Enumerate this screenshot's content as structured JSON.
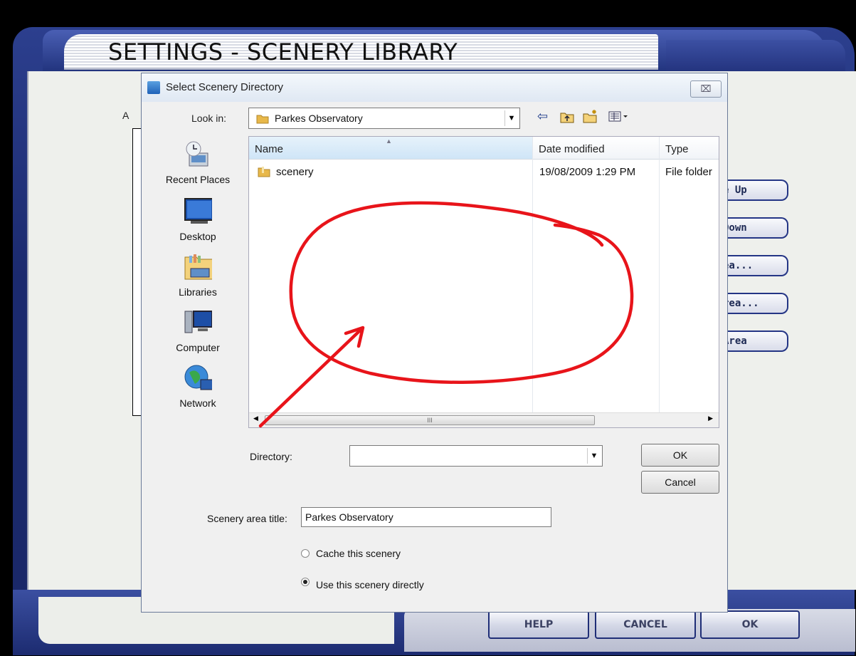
{
  "app": {
    "title": "SETTINGS - SCENERY LIBRARY"
  },
  "background": {
    "list_header": "A",
    "side_buttons": [
      "e Up",
      "Down",
      "ea...",
      "rea...",
      "Area"
    ],
    "footer_buttons": {
      "help": "HELP",
      "cancel": "CANCEL",
      "ok": "OK"
    }
  },
  "dialog": {
    "title": "Select Scenery Directory",
    "close": "⌧",
    "look_in_label": "Look in:",
    "look_in_value": "Parkes Observatory",
    "places": [
      "Recent Places",
      "Desktop",
      "Libraries",
      "Computer",
      "Network"
    ],
    "columns": [
      "Name",
      "Date modified",
      "Type"
    ],
    "files": [
      {
        "name": "scenery",
        "date": "19/08/2009 1:29 PM",
        "type": "File folder"
      }
    ],
    "scroll_grip": "III",
    "directory_label": "Directory:",
    "directory_value": "",
    "ok_label": "OK",
    "cancel_label": "Cancel",
    "scenery_title_label": "Scenery area title:",
    "scenery_title_value": "Parkes Observatory",
    "options": [
      {
        "label": "Cache this scenery",
        "selected": false
      },
      {
        "label": "Use this scenery directly",
        "selected": true
      }
    ]
  },
  "colors": {
    "frame": "#1b2a6e",
    "annotation": "#e8141a",
    "dialog_bg": "#f0f0f0"
  },
  "icons": [
    "back-arrow-icon",
    "up-folder-icon",
    "new-folder-icon",
    "views-menu-icon",
    "folder-icon"
  ]
}
